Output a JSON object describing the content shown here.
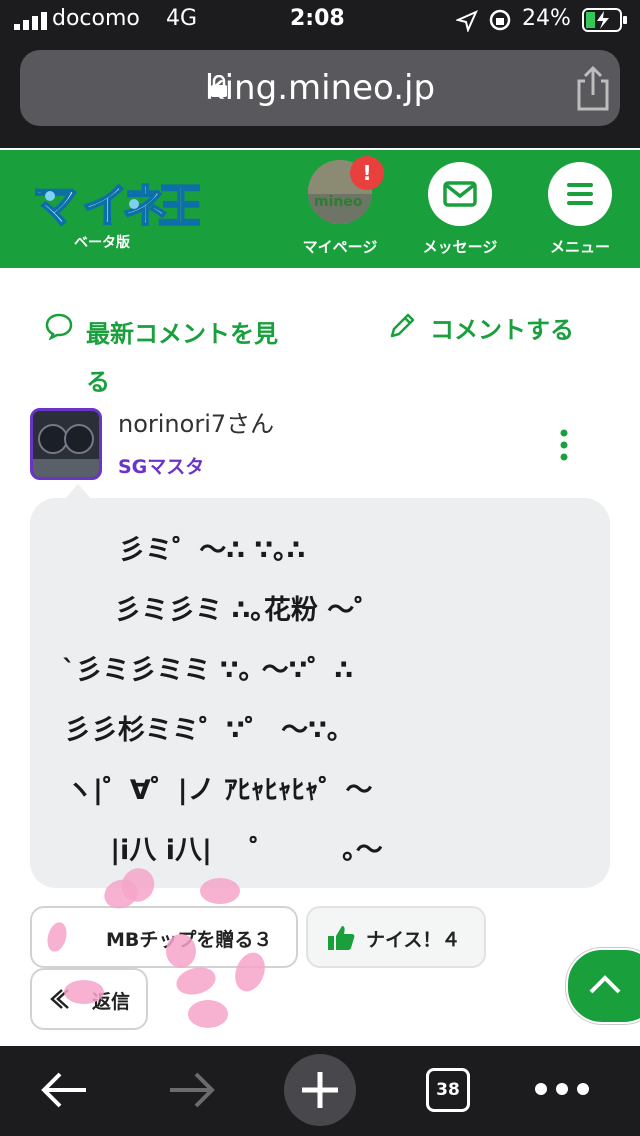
{
  "status_bar": {
    "carrier": "docomo",
    "network": "4G",
    "time": "2:08",
    "battery": "24%"
  },
  "browser": {
    "url": "king.mineo.jp",
    "tab_count": "38"
  },
  "header": {
    "beta_label": "ベータ版",
    "mypage_label": "マイページ",
    "mypage_badge": "!",
    "message_label": "メッセージ",
    "menu_label": "メニュー",
    "brand_color": "#19a03c"
  },
  "actions": {
    "latest_comments": "最新コメントを見る",
    "comment": "コメントする"
  },
  "post": {
    "username": "norinori7さん",
    "rank": "SGマスタ",
    "lines": [
      "   彡ミ゜〜∴ ∵｡∴",
      "   彡ミ彡ミ ∴｡花粉 〜゜",
      "`彡ミ彡ミミ ∵｡ 〜∵゜∴",
      "彡彡杉ミミ゜∵゜ 〜∵｡",
      "ヽ|゜∀゜|ノ ｱﾋｬﾋｬﾋｬ゜〜",
      "   |i八 i八|    ゜       ｡〜"
    ],
    "chip_button": "MBチップを贈る３",
    "nice_button": "ナイス！４",
    "reply_button": "返信"
  }
}
